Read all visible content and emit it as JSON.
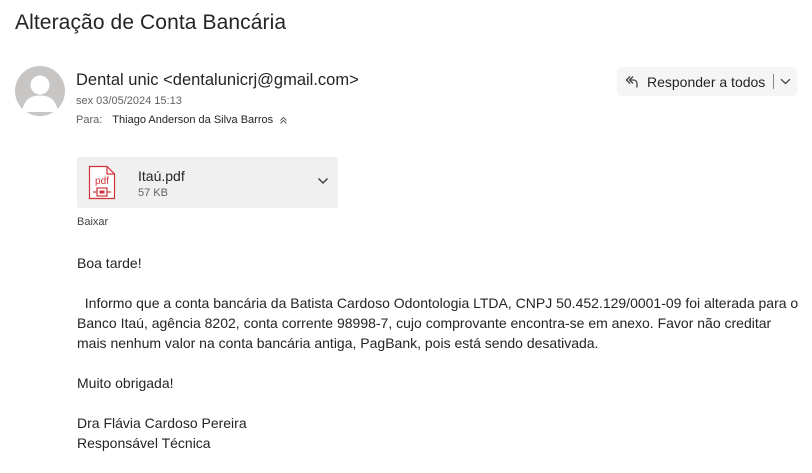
{
  "email": {
    "subject": "Alteração de Conta Bancária",
    "sender": "Dental unic <dentalunicrj@gmail.com>",
    "date": "sex 03/05/2024 15:13",
    "to_label": "Para:",
    "recipient": "Thiago Anderson da Silva Barros",
    "reply_all_label": "Responder a todos",
    "attachment": {
      "name": "Itaú.pdf",
      "size": "57 KB",
      "type_icon": "pdf-file-icon",
      "download_label": "Baixar"
    },
    "body": {
      "greeting": "Boa tarde!",
      "paragraph": "  Informo que a conta bancária da Batista Cardoso Odontologia LTDA, CNPJ 50.452.129/0001-09 foi alterada para o Banco Itaú, agência 8202, conta corrente 98998-7, cujo comprovante encontra-se em anexo. Favor não creditar mais nenhum valor na conta bancária antiga, PagBank, pois está sendo desativada.",
      "thanks": "Muito obrigada!",
      "signature_name": "Dra Flávia Cardoso Pereira",
      "signature_title": "Responsável Técnica"
    }
  },
  "colors": {
    "text": "#242424",
    "secondary_text": "#616161",
    "avatar_bg": "#c8c6c4",
    "pdf_red": "#d13438",
    "attachment_bg": "#f0f0f0"
  }
}
